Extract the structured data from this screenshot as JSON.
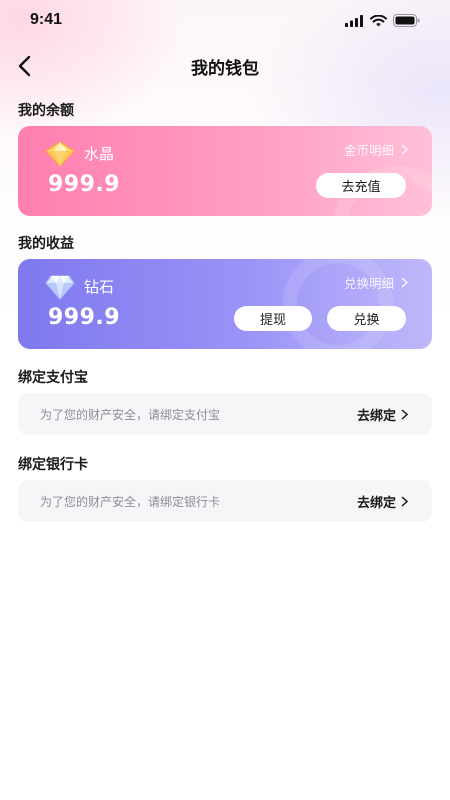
{
  "status_bar": {
    "time": "9:41"
  },
  "header": {
    "title": "我的钱包"
  },
  "balance_section": {
    "title": "我的余额",
    "currency_name": "水晶",
    "amount": "999.9",
    "detail_link": "金币明细",
    "recharge_button": "去充值",
    "icon": "crystal-gem-icon"
  },
  "earnings_section": {
    "title": "我的收益",
    "currency_name": "钻石",
    "amount": "999.9",
    "detail_link": "兑换明细",
    "withdraw_button": "提现",
    "exchange_button": "兑换",
    "icon": "diamond-icon"
  },
  "alipay_section": {
    "title": "绑定支付宝",
    "hint": "为了您的财产安全，请绑定支付宝",
    "action": "去绑定"
  },
  "bank_section": {
    "title": "绑定银行卡",
    "hint": "为了您的财产安全，请绑定银行卡",
    "action": "去绑定"
  },
  "colors": {
    "balance_card": "#ff8fbb",
    "earnings_card": "#8c86f3",
    "bind_row_bg": "#f6f6f8"
  }
}
